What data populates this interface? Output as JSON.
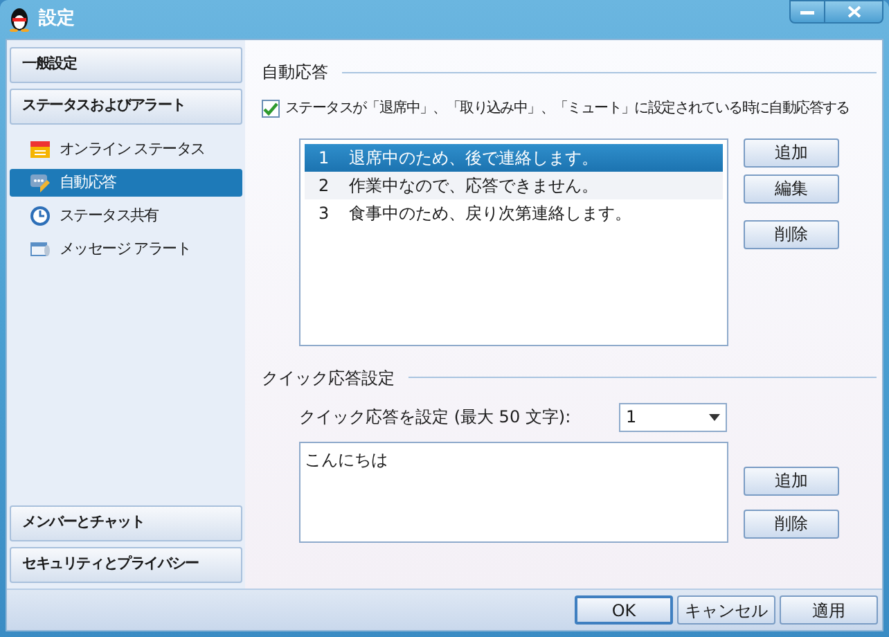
{
  "window": {
    "title": "設定"
  },
  "sidebar": {
    "top_sections": [
      {
        "label": "一般設定"
      },
      {
        "label": "ステータスおよびアラート"
      }
    ],
    "items": [
      {
        "label": "オンライン ステータス",
        "selected": false
      },
      {
        "label": "自動応答",
        "selected": true
      },
      {
        "label": "ステータス共有",
        "selected": false
      },
      {
        "label": "メッセージ アラート",
        "selected": false
      }
    ],
    "bottom_sections": [
      {
        "label": "メンバーとチャット"
      },
      {
        "label": "セキュリティとプライバシー"
      }
    ]
  },
  "auto_reply": {
    "heading": "自動応答",
    "enable_checkbox": {
      "label": "ステータスが「退席中」、「取り込み中」、「ミュート」に設定されている時に自動応答する",
      "checked": true
    },
    "replies": [
      {
        "number": "1",
        "text": "退席中のため、後で連絡します。",
        "selected": true
      },
      {
        "number": "2",
        "text": "作業中なので、応答できません。",
        "selected": false
      },
      {
        "number": "3",
        "text": "食事中のため、戻り次第連絡します。",
        "selected": false
      }
    ],
    "buttons": [
      "追加",
      "編集",
      "削除"
    ]
  },
  "quick_reply": {
    "heading": "クイック応答設定",
    "label": "クイック応答を設定 (最大 50 文字):",
    "dropdown": {
      "value": "1"
    },
    "text": {
      "value": "こんにちは"
    },
    "buttons": [
      "追加",
      "削除"
    ]
  },
  "footer_buttons": [
    {
      "label": "OK",
      "default": true
    },
    {
      "label": "キャンセル",
      "default": false
    },
    {
      "label": "適用",
      "default": false
    }
  ]
}
